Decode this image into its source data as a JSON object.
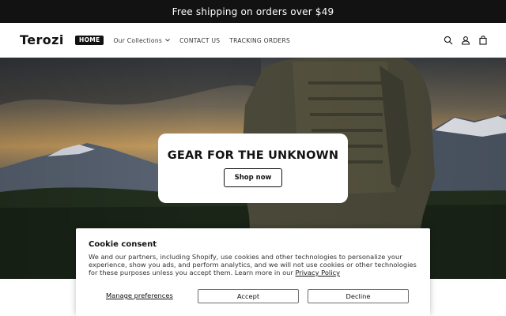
{
  "announcement": {
    "text": "Free shipping on orders over $49"
  },
  "header": {
    "logo": "Terozi",
    "nav": [
      {
        "label": "HOME",
        "active": true
      },
      {
        "label": "Our Collections",
        "has_dropdown": true
      },
      {
        "label": "CONTACT US"
      },
      {
        "label": "TRACKING ORDERS"
      }
    ],
    "icons": [
      "search-icon",
      "account-icon",
      "cart-icon"
    ]
  },
  "hero": {
    "title": "GEAR FOR THE UNKNOWN",
    "button_label": "Shop now"
  },
  "cookie": {
    "title": "Cookie consent",
    "body": "We and our partners, including Shopify, use cookies and other technologies to personalize your experience, show you ads, and perform analytics, and we will not use cookies or other technologies for these purposes unless you accept them. Learn more in our ",
    "privacy_link": "Privacy Policy",
    "manage_label": "Manage preferences",
    "accept_label": "Accept",
    "decline_label": "Decline"
  },
  "colors": {
    "brand_dark": "#121212",
    "announcement_bg": "#121212"
  }
}
